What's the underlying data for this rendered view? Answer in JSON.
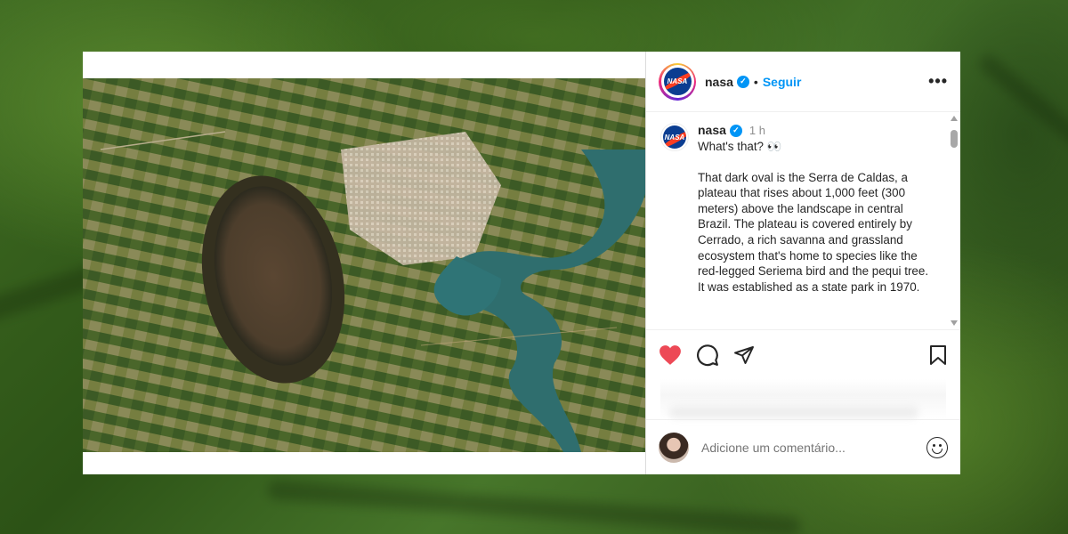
{
  "header": {
    "username": "nasa",
    "separator": "•",
    "follow_label": "Seguir",
    "more_label": "•••"
  },
  "caption": {
    "username": "nasa",
    "time": "1 h",
    "line1": "What's that? 👀",
    "body": "That dark oval is the Serra de Caldas, a plateau that rises about 1,000 feet (300 meters) above the landscape in central Brazil. The plateau is covered entirely by Cerrado, a rich savanna and grassland ecosystem that's home to species like the red-legged Seriema bird and the pequi tree. It was established as a state park in 1970."
  },
  "logo_text": "NASA",
  "comment": {
    "placeholder": "Adicione um comentário..."
  },
  "colors": {
    "like": "#ed4956",
    "follow": "#0095f6",
    "verified": "#0095f6"
  },
  "icons": {
    "like": "heart-icon",
    "comment": "comment-icon",
    "share": "send-icon",
    "save": "bookmark-icon",
    "emoji": "smiley-icon"
  }
}
